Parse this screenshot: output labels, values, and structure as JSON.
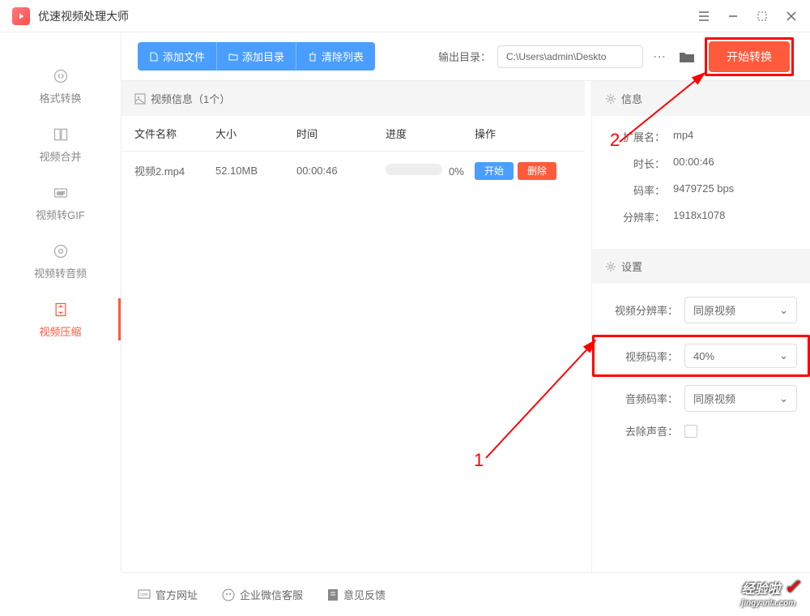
{
  "app": {
    "title": "优速视频处理大师"
  },
  "sidebar": {
    "items": [
      {
        "label": "格式转换"
      },
      {
        "label": "视频合并"
      },
      {
        "label": "视频转GIF"
      },
      {
        "label": "视频转音频"
      },
      {
        "label": "视频压缩"
      }
    ]
  },
  "toolbar": {
    "add_file": "添加文件",
    "add_dir": "添加目录",
    "clear_list": "清除列表",
    "output_label": "输出目录：",
    "output_path": "C:\\Users\\admin\\Deskto",
    "start_convert": "开始转换"
  },
  "table": {
    "title": "视频信息（1个）",
    "headers": {
      "name": "文件名称",
      "size": "大小",
      "time": "时间",
      "progress": "进度",
      "action": "操作"
    },
    "rows": [
      {
        "name": "视频2.mp4",
        "size": "52.10MB",
        "time": "00:00:46",
        "progress": "0%",
        "start": "开始",
        "delete": "删除"
      }
    ]
  },
  "info_panel": {
    "title": "信息",
    "ext_label": "扩展名：",
    "ext": "mp4",
    "duration_label": "时长：",
    "duration": "00:00:46",
    "bitrate_label": "码率：",
    "bitrate": "9479725 bps",
    "resolution_label": "分辨率：",
    "resolution": "1918x1078"
  },
  "settings_panel": {
    "title": "设置",
    "res_label": "视频分辨率：",
    "res_value": "同原视频",
    "vbitrate_label": "视频码率：",
    "vbitrate_value": "40%",
    "abitrate_label": "音频码率：",
    "abitrate_value": "同原视频",
    "remove_audio_label": "去除声音："
  },
  "footer": {
    "site": "官方网址",
    "wechat": "企业微信客服",
    "feedback": "意见反馈"
  },
  "annotations": {
    "a1": "1",
    "a2": "2"
  },
  "watermark": {
    "text": "经验啦",
    "sub": "jingyanla.com"
  }
}
